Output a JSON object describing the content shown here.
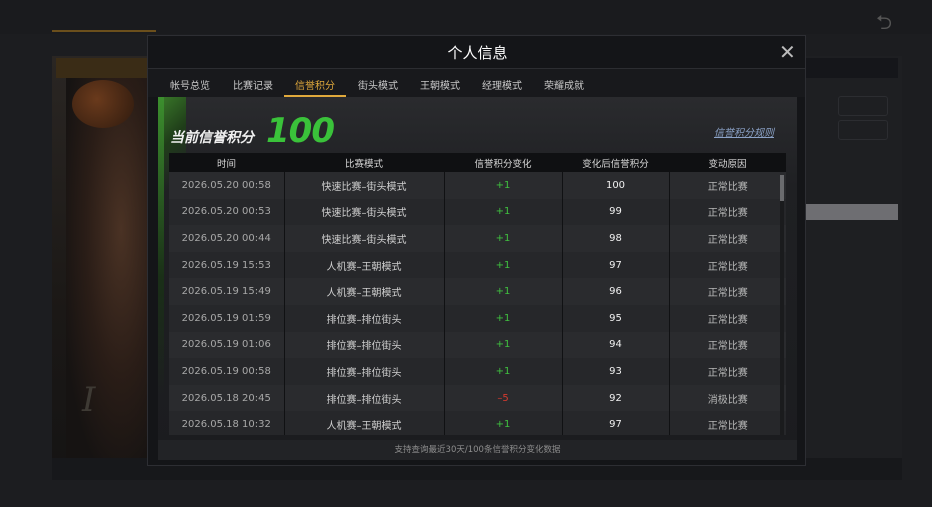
{
  "modal": {
    "title": "个人信息",
    "tabs": [
      {
        "label": "帐号总览"
      },
      {
        "label": "比赛记录"
      },
      {
        "label": "信誉积分"
      },
      {
        "label": "街头模式"
      },
      {
        "label": "王朝模式"
      },
      {
        "label": "经理模式"
      },
      {
        "label": "荣耀成就"
      }
    ],
    "active_tab": "信誉积分"
  },
  "credit": {
    "label": "当前信誉积分",
    "value": "100",
    "rules_link": "信誉积分规则"
  },
  "table": {
    "headers": [
      "时间",
      "比赛模式",
      "信誉积分变化",
      "变化后信誉积分",
      "变动原因"
    ],
    "rows": [
      {
        "time": "2026.05.20  00:58",
        "mode": "快速比赛–街头模式",
        "change": "+1",
        "after": "100",
        "reason": "正常比赛"
      },
      {
        "time": "2026.05.20  00:53",
        "mode": "快速比赛–街头模式",
        "change": "+1",
        "after": "99",
        "reason": "正常比赛"
      },
      {
        "time": "2026.05.20  00:44",
        "mode": "快速比赛–街头模式",
        "change": "+1",
        "after": "98",
        "reason": "正常比赛"
      },
      {
        "time": "2026.05.19  15:53",
        "mode": "人机赛–王朝模式",
        "change": "+1",
        "after": "97",
        "reason": "正常比赛"
      },
      {
        "time": "2026.05.19  15:49",
        "mode": "人机赛–王朝模式",
        "change": "+1",
        "after": "96",
        "reason": "正常比赛"
      },
      {
        "time": "2026.05.19  01:59",
        "mode": "排位赛–排位街头",
        "change": "+1",
        "after": "95",
        "reason": "正常比赛"
      },
      {
        "time": "2026.05.19  01:06",
        "mode": "排位赛–排位街头",
        "change": "+1",
        "after": "94",
        "reason": "正常比赛"
      },
      {
        "time": "2026.05.19  00:58",
        "mode": "排位赛–排位街头",
        "change": "+1",
        "after": "93",
        "reason": "正常比赛"
      },
      {
        "time": "2026.05.18  20:45",
        "mode": "排位赛–排位街头",
        "change": "–5",
        "after": "92",
        "reason": "消极比赛"
      },
      {
        "time": "2026.05.18  10:32",
        "mode": "人机赛–王朝模式",
        "change": "+1",
        "after": "97",
        "reason": "正常比赛"
      }
    ]
  },
  "footer_note": "支持查询最近30天/100条信誉积分变化数据",
  "colors": {
    "accent": "#e0a93c",
    "positive": "#3fc03f",
    "negative": "#d53a2e",
    "score": "#3ac23a"
  }
}
